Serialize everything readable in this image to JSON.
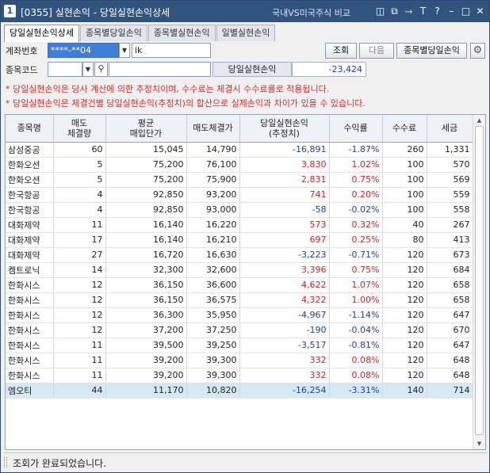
{
  "window": {
    "number": "1",
    "title": "[0355] 실현손익 - 당일실현손익상세",
    "link": "국내VS미국주식 비교"
  },
  "tabs": [
    {
      "label": "당일실현손익상세",
      "active": true
    },
    {
      "label": "종목별당일손익",
      "active": false
    },
    {
      "label": "종목별실현손익",
      "active": false
    },
    {
      "label": "일별실현손익",
      "active": false
    }
  ],
  "form": {
    "account_label": "계좌번호",
    "account_value": "****-**04",
    "account_name": "ik",
    "stock_label": "종목코드",
    "stock_code": "",
    "stock_name": "",
    "search_button": "조회",
    "next_button": "다음",
    "by_stock_button": "종목별당일손익",
    "sum_label": "당일실현손익",
    "sum_value": "-23,424"
  },
  "notes": [
    "* 당일실현손익은 당사 계산에 의한 추정치이며, 수수료는 체결시 수수료률로 적용됩니다.",
    "* 당일실현손익은 체결건별 당일실현손익(추정치)의 합산으로 실제손익과 차이가 있을 수 있습니다."
  ],
  "table": {
    "headers": [
      {
        "line1": "종목명",
        "line2": ""
      },
      {
        "line1": "매도",
        "line2": "체결량"
      },
      {
        "line1": "평균",
        "line2": "매입단가"
      },
      {
        "line1": "매도체결가",
        "line2": ""
      },
      {
        "line1": "당일실현손익",
        "line2": "(추정치)"
      },
      {
        "line1": "수익률",
        "line2": ""
      },
      {
        "line1": "수수료",
        "line2": ""
      },
      {
        "line1": "세금",
        "line2": ""
      }
    ],
    "rows": [
      {
        "name": "삼성중공",
        "qty": "60",
        "avg": "15,045",
        "sell": "14,790",
        "pnl": "-16,891",
        "rate": "-1.87%",
        "fee": "260",
        "tax": "1,331",
        "sign": "neg"
      },
      {
        "name": "한화오션",
        "qty": "5",
        "avg": "75,200",
        "sell": "76,100",
        "pnl": "3,830",
        "rate": "1.02%",
        "fee": "100",
        "tax": "570",
        "sign": "pos"
      },
      {
        "name": "한화오션",
        "qty": "5",
        "avg": "75,200",
        "sell": "75,900",
        "pnl": "2,831",
        "rate": "0.75%",
        "fee": "100",
        "tax": "569",
        "sign": "pos"
      },
      {
        "name": "한국항공",
        "qty": "4",
        "avg": "92,850",
        "sell": "93,200",
        "pnl": "741",
        "rate": "0.20%",
        "fee": "100",
        "tax": "559",
        "sign": "pos"
      },
      {
        "name": "한국항공",
        "qty": "4",
        "avg": "92,850",
        "sell": "93,000",
        "pnl": "-58",
        "rate": "-0.02%",
        "fee": "100",
        "tax": "558",
        "sign": "neg"
      },
      {
        "name": "대화제약",
        "qty": "11",
        "avg": "16,140",
        "sell": "16,220",
        "pnl": "573",
        "rate": "0.32%",
        "fee": "40",
        "tax": "267",
        "sign": "pos"
      },
      {
        "name": "대화제약",
        "qty": "17",
        "avg": "16,140",
        "sell": "16,210",
        "pnl": "697",
        "rate": "0.25%",
        "fee": "80",
        "tax": "413",
        "sign": "pos"
      },
      {
        "name": "대화제약",
        "qty": "27",
        "avg": "16,720",
        "sell": "16,630",
        "pnl": "-3,223",
        "rate": "-0.71%",
        "fee": "120",
        "tax": "673",
        "sign": "neg"
      },
      {
        "name": "켐트로닉",
        "qty": "14",
        "avg": "32,300",
        "sell": "32,600",
        "pnl": "3,396",
        "rate": "0.75%",
        "fee": "120",
        "tax": "684",
        "sign": "pos"
      },
      {
        "name": "한화시스",
        "qty": "12",
        "avg": "36,150",
        "sell": "36,600",
        "pnl": "4,622",
        "rate": "1.07%",
        "fee": "120",
        "tax": "658",
        "sign": "pos"
      },
      {
        "name": "한화시스",
        "qty": "12",
        "avg": "36,150",
        "sell": "36,575",
        "pnl": "4,322",
        "rate": "1.00%",
        "fee": "120",
        "tax": "658",
        "sign": "pos"
      },
      {
        "name": "한화시스",
        "qty": "12",
        "avg": "36,300",
        "sell": "35,950",
        "pnl": "-4,967",
        "rate": "-1.14%",
        "fee": "120",
        "tax": "647",
        "sign": "neg"
      },
      {
        "name": "한화시스",
        "qty": "12",
        "avg": "37,200",
        "sell": "37,250",
        "pnl": "-190",
        "rate": "-0.04%",
        "fee": "120",
        "tax": "670",
        "sign": "neg"
      },
      {
        "name": "한화시스",
        "qty": "11",
        "avg": "39,500",
        "sell": "39,250",
        "pnl": "-3,517",
        "rate": "-0.81%",
        "fee": "120",
        "tax": "647",
        "sign": "neg"
      },
      {
        "name": "한화시스",
        "qty": "11",
        "avg": "39,200",
        "sell": "39,300",
        "pnl": "332",
        "rate": "0.08%",
        "fee": "120",
        "tax": "648",
        "sign": "pos"
      },
      {
        "name": "한화시스",
        "qty": "11",
        "avg": "39,200",
        "sell": "39,300",
        "pnl": "332",
        "rate": "0.08%",
        "fee": "120",
        "tax": "648",
        "sign": "pos"
      },
      {
        "name": "엠오티",
        "qty": "44",
        "avg": "11,170",
        "sell": "10,820",
        "pnl": "-16,254",
        "rate": "-3.31%",
        "fee": "140",
        "tax": "714",
        "sign": "neg"
      }
    ],
    "selected_row": 16
  },
  "status": "조회가 완료되었습니다.",
  "colors": {
    "titlebar": "#31547f",
    "negative": "#1b3faf",
    "positive": "#d92020",
    "selected_row": "#d5e9f5"
  }
}
